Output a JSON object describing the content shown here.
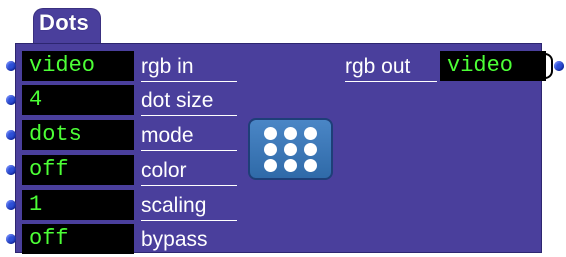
{
  "actor": {
    "title": "Dots",
    "icon": "dots-grid-icon"
  },
  "inputs": [
    {
      "value": "video",
      "label": "rgb in"
    },
    {
      "value": "4",
      "label": "dot size"
    },
    {
      "value": "dots",
      "label": "mode"
    },
    {
      "value": "off",
      "label": "color"
    },
    {
      "value": "1",
      "label": "scaling"
    },
    {
      "value": "off",
      "label": "bypass"
    }
  ],
  "outputs": [
    {
      "label": "rgb out",
      "value": "video"
    }
  ],
  "colors": {
    "panel": "#4a3f9c",
    "field_bg": "#000000",
    "field_text": "#4cff36",
    "pin": "#2d4fd6",
    "icon_bg": "#3a78b8"
  }
}
